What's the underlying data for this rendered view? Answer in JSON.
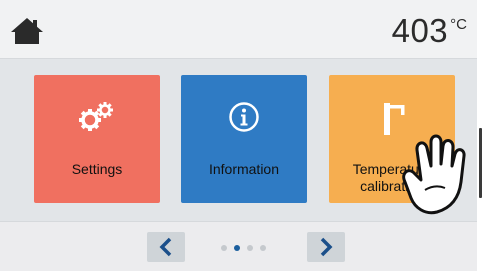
{
  "header": {
    "home_icon": "home-icon",
    "temperature_value": "403",
    "temperature_unit": "°C"
  },
  "tiles": [
    {
      "label": "Settings",
      "icon": "gears-icon",
      "color": "#f07060"
    },
    {
      "label": "Information",
      "icon": "info-icon",
      "color": "#2f7bc4"
    },
    {
      "label_line1": "Temperature",
      "label_line2": "calibration",
      "icon": "temperature-calibration-icon",
      "color": "#f6ae50"
    }
  ],
  "pager": {
    "prev_icon": "chevron-left-icon",
    "next_icon": "chevron-right-icon",
    "page_count": 4,
    "active_page": 2
  },
  "overlay": {
    "icon": "pointing-hand-icon"
  }
}
